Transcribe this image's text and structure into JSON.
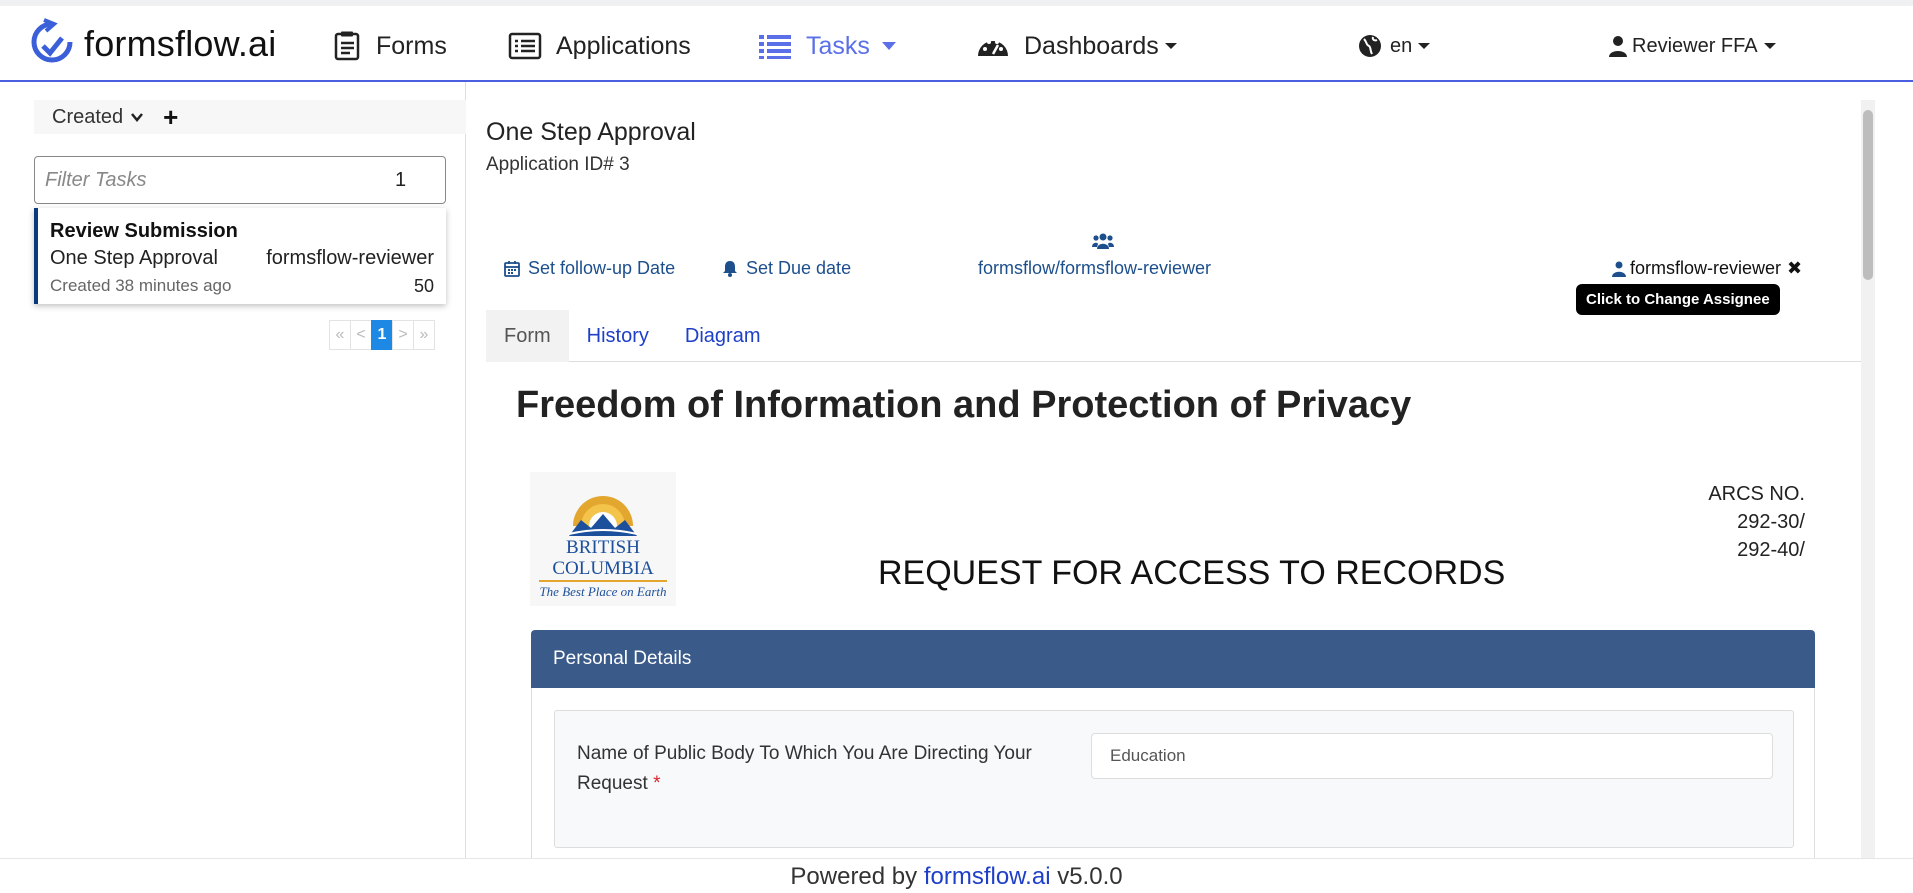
{
  "navbar": {
    "brand": "formsflow.ai",
    "items": [
      {
        "label": "Forms",
        "icon": "forms-icon"
      },
      {
        "label": "Applications",
        "icon": "applications-icon"
      },
      {
        "label": "Tasks",
        "icon": "list-icon"
      },
      {
        "label": "Dashboards",
        "icon": "dashboard-icon"
      }
    ],
    "language": "en",
    "user": "Reviewer FFA",
    "accent_color": "#5a6fe8"
  },
  "task_list": {
    "sort_label": "Created",
    "filter_placeholder": "Filter Tasks",
    "filter_count": "1",
    "tasks": [
      {
        "title": "Review Submission",
        "process": "One Step Approval",
        "assignee": "formsflow-reviewer",
        "created": "Created 38 minutes ago",
        "priority": "50"
      }
    ],
    "pagination": [
      "«",
      "<",
      "1",
      ">",
      "»"
    ]
  },
  "task_detail": {
    "process_name": "One Step Approval",
    "application_id": "Application ID# 3",
    "follow_up_label": "Set follow-up Date",
    "due_date_label": "Set Due date",
    "group": "formsflow/formsflow-reviewer",
    "assignee": "formsflow-reviewer",
    "tooltip": "Click to Change Assignee",
    "tabs": [
      "Form",
      "History",
      "Diagram"
    ]
  },
  "form": {
    "title": "Freedom of Information and Protection of Privacy",
    "logo_line1": "BRITISH",
    "logo_line2": "COLUMBIA",
    "logo_tagline": "The Best Place on Earth",
    "arcs_lines": [
      "ARCS NO.",
      "292-30/",
      "292-40/"
    ],
    "request_title": "REQUEST FOR ACCESS TO RECORDS",
    "section_title": "Personal Details",
    "field_label": "Name of Public Body To Which You Are Directing Your Request",
    "field_required": "*",
    "field_value": "Education"
  },
  "footer": {
    "prefix": "Powered by",
    "link": "formsflow.ai",
    "version": "v5.0.0"
  }
}
